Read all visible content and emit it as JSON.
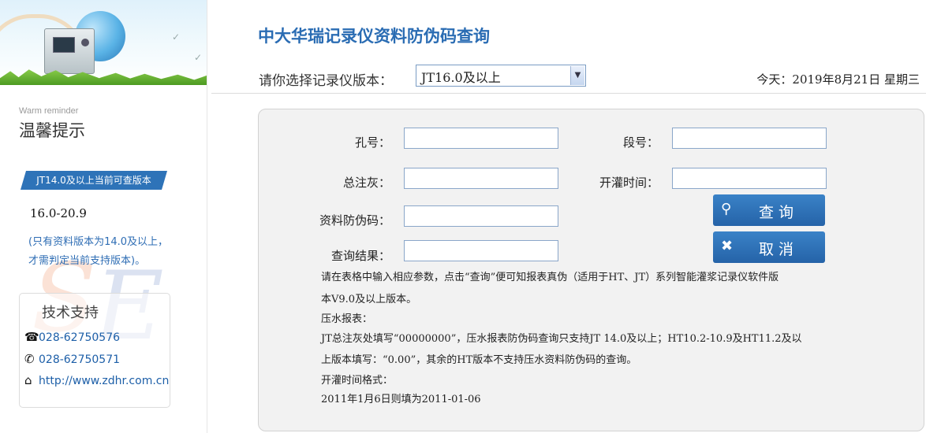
{
  "sidebar": {
    "warm_reminder_en": "Warm reminder",
    "warm_reminder_cn": "温馨提示",
    "version_badge": "JT14.0及以上当前可查版本",
    "version_range": "16.0-20.9",
    "note_line1": "(只有资料版本为14.0及以上，",
    "note_line2": "才需判定当前支持版本)。",
    "support": {
      "title": "技术支持",
      "phone1": "028-62750576",
      "phone2": "028-62750571",
      "website": "http://www.zdhr.com.cn"
    }
  },
  "header": {
    "title": "中大华瑞记录仪资料防伪码查询",
    "version_label": "请你选择记录仪版本：",
    "version_selected": "JT16.0及以上",
    "today": "今天：2019年8月21日 星期三"
  },
  "form": {
    "hole_label": "孔号：",
    "section_label": "段号：",
    "total_ash_label": "总注灰：",
    "start_time_label": "开灌时间：",
    "code_label": "资料防伪码：",
    "result_label": "查询结果：",
    "hole_value": "",
    "section_value": "",
    "total_ash_value": "",
    "start_time_value": "",
    "code_value": "",
    "result_value": "",
    "query_button": "查询",
    "cancel_button": "取消"
  },
  "instructions": {
    "line1": "请在表格中输入相应参数，点击“查询”便可知报表真伪（适用于HT、JT）系列智能灌浆记录仪软件版",
    "line2": "本V9.0及以上版本。",
    "line3": "压水报表：",
    "line4": "JT总注灰处填写“00000000”，压水报表防伪码查询只支持JT 14.0及以上；HT10.2-10.9及HT11.2及以",
    "line5": "上版本填写：“0.00”，其余的HT版本不支持压水资料防伪码的查询。",
    "line6": "开灌时间格式：",
    "line7": "2011年1月6日则填为2011-01-06"
  },
  "colors": {
    "accent": "#2a6cb3",
    "button": "#2e6db4",
    "panel": "#f2f2f2"
  },
  "icons": {
    "phone1": "telephone-icon",
    "phone2": "phone-icon",
    "website": "home-icon",
    "query": "search-icon",
    "cancel": "close-icon",
    "dropdown": "chevron-down-icon"
  }
}
